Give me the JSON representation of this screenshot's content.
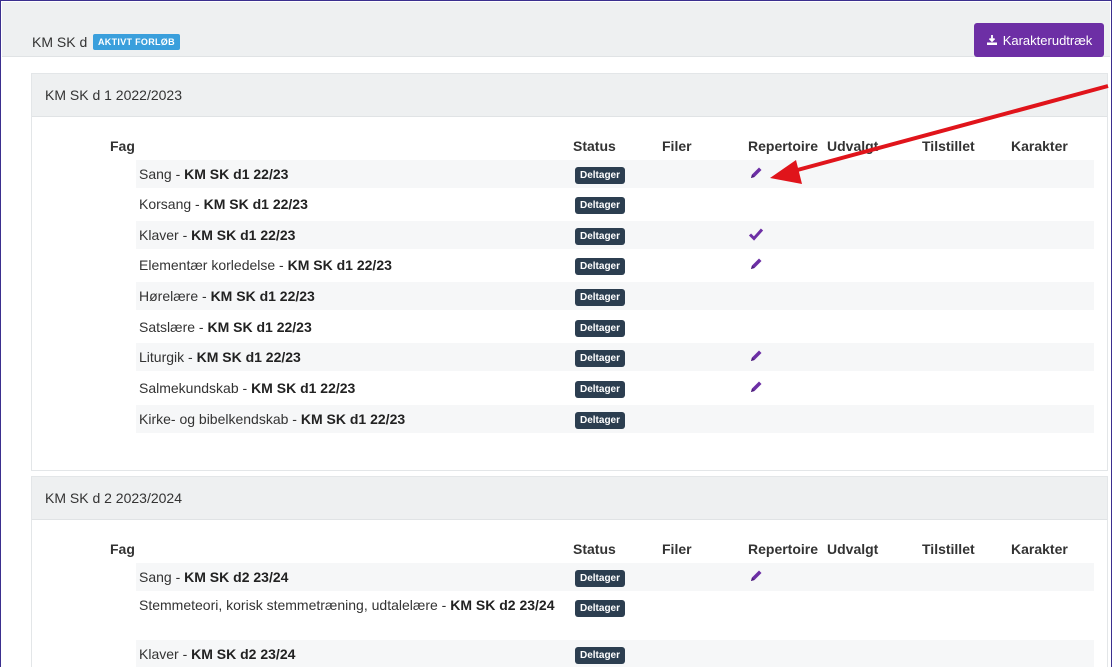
{
  "header": {
    "title": "KM SK d",
    "status_badge": "AKTIVT FORLØB",
    "export_label": "Karakterudtræk",
    "export_icon": "download-icon"
  },
  "columns": {
    "fag": "Fag",
    "status": "Status",
    "filer": "Filer",
    "repertoire": "Repertoire",
    "udvalgt": "Udvalgt",
    "tilstillet": "Tilstillet",
    "karakter": "Karakter"
  },
  "colors": {
    "accent": "#6d2fa5",
    "badge_blue": "#3a9fdc",
    "badge_dark": "#2c3e50",
    "arrow": "#e0141b"
  },
  "periods": [
    {
      "title": "KM SK d 1 2022/2023",
      "rows": [
        {
          "fag": "Sang - ",
          "class": "KM SK d1 22/23",
          "status": "Deltager",
          "repertoire_icon": "pencil-icon"
        },
        {
          "fag": "Korsang - ",
          "class": "KM SK d1 22/23",
          "status": "Deltager",
          "repertoire_icon": ""
        },
        {
          "fag": "Klaver - ",
          "class": "KM SK d1 22/23",
          "status": "Deltager",
          "repertoire_icon": "check-icon"
        },
        {
          "fag": "Elementær korledelse - ",
          "class": "KM SK d1 22/23",
          "status": "Deltager",
          "repertoire_icon": "pencil-icon"
        },
        {
          "fag": "Hørelære - ",
          "class": "KM SK d1 22/23",
          "status": "Deltager",
          "repertoire_icon": ""
        },
        {
          "fag": "Satslære - ",
          "class": "KM SK d1 22/23",
          "status": "Deltager",
          "repertoire_icon": ""
        },
        {
          "fag": "Liturgik - ",
          "class": "KM SK d1 22/23",
          "status": "Deltager",
          "repertoire_icon": "pencil-icon"
        },
        {
          "fag": "Salmekundskab - ",
          "class": "KM SK d1 22/23",
          "status": "Deltager",
          "repertoire_icon": "pencil-icon"
        },
        {
          "fag": "Kirke- og bibelkendskab - ",
          "class": "KM SK d1 22/23",
          "status": "Deltager",
          "repertoire_icon": ""
        }
      ]
    },
    {
      "title": "KM SK d 2 2023/2024",
      "rows": [
        {
          "fag": "Sang - ",
          "class": "KM SK d2 23/24",
          "status": "Deltager",
          "repertoire_icon": "pencil-icon"
        },
        {
          "fag": "Stemmeteori, korisk stemmetræning, udtalelære - ",
          "class": "KM SK d2 23/24",
          "status": "Deltager",
          "repertoire_icon": ""
        },
        {
          "fag": "Klaver - ",
          "class": "KM SK d2 23/24",
          "status": "Deltager",
          "repertoire_icon": ""
        }
      ]
    }
  ]
}
